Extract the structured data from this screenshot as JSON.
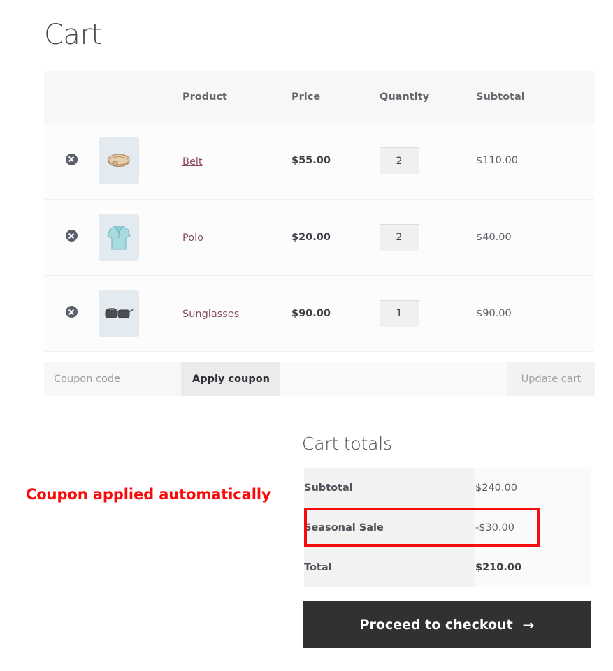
{
  "page": {
    "title": "Cart"
  },
  "cart_table": {
    "headers": [
      "",
      "",
      "Product",
      "Price",
      "Quantity",
      "Subtotal"
    ],
    "header_product": "Product",
    "header_price": "Price",
    "header_quantity": "Quantity",
    "header_subtotal": "Subtotal",
    "rows": [
      {
        "remove_icon": "remove-circle-x-icon",
        "thumbnail_icon": "belt-product-thumbnail",
        "name": "Belt",
        "price": "$55.00",
        "quantity": "2",
        "subtotal": "$110.00"
      },
      {
        "remove_icon": "remove-circle-x-icon",
        "thumbnail_icon": "polo-shirt-product-thumbnail",
        "name": "Polo",
        "price": "$20.00",
        "quantity": "2",
        "subtotal": "$40.00"
      },
      {
        "remove_icon": "remove-circle-x-icon",
        "thumbnail_icon": "sunglasses-product-thumbnail",
        "name": "Sunglasses",
        "price": "$90.00",
        "quantity": "1",
        "subtotal": "$90.00"
      }
    ]
  },
  "coupon": {
    "placeholder": "Coupon code",
    "value": "",
    "apply_label": "Apply coupon",
    "update_cart_label": "Update cart"
  },
  "totals": {
    "title": "Cart totals",
    "rows": [
      {
        "label": "Subtotal",
        "value": "$240.00"
      },
      {
        "label": "Seasonal Sale",
        "value": "-$30.00"
      },
      {
        "label": "Total",
        "value": "$210.00"
      }
    ]
  },
  "annotation": {
    "text": "Coupon applied automatically",
    "color": "#fa0a0a",
    "highlight_border_color": "#f50c0c",
    "highlights_row": "Seasonal Sale"
  },
  "checkout": {
    "label": "Proceed to checkout",
    "arrow_icon": "arrow-right-icon",
    "arrow_glyph": "→",
    "background": "#31312f"
  }
}
